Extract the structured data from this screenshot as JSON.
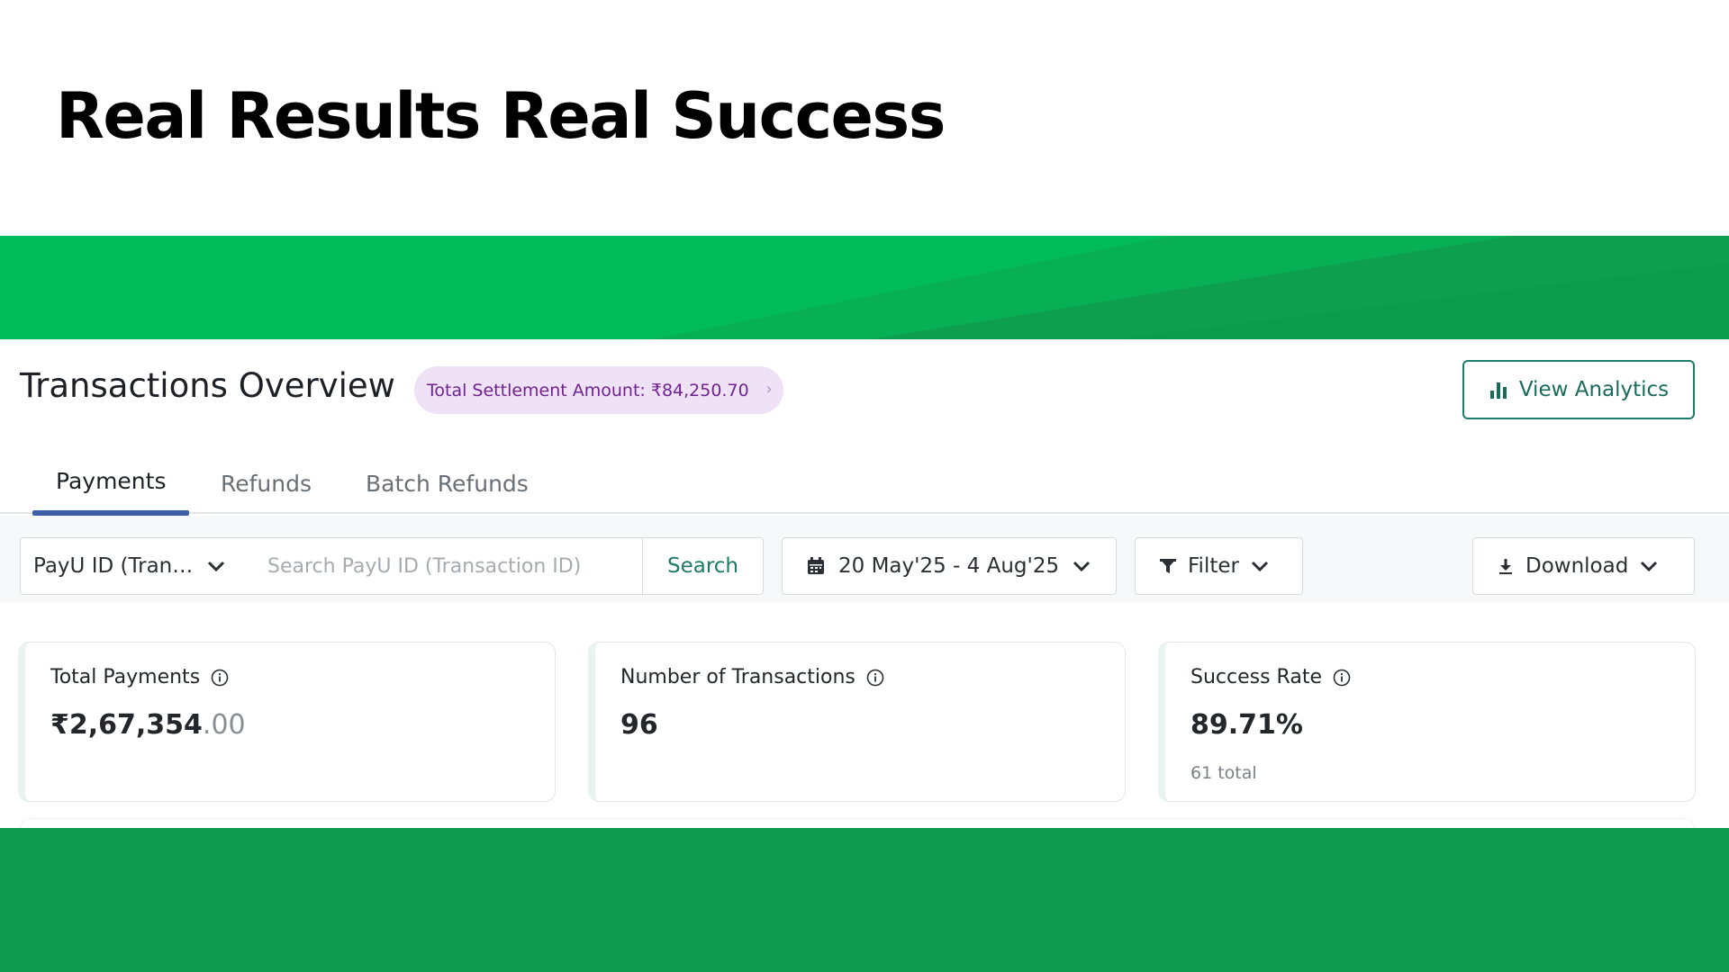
{
  "headline": "Real Results Real Success",
  "overview": {
    "title": "Transactions Overview",
    "settlement_label": "Total Settlement Amount: ₹84,250.70",
    "view_analytics_label": "View Analytics"
  },
  "tabs": [
    {
      "label": "Payments",
      "active": true
    },
    {
      "label": "Refunds",
      "active": false
    },
    {
      "label": "Batch Refunds",
      "active": false
    }
  ],
  "toolbar": {
    "search_type": "PayU ID (Trans...",
    "search_placeholder": "Search PayU ID (Transaction ID)",
    "search_button": "Search",
    "date_range": "20 May'25 - 4 Aug'25",
    "filter_label": "Filter",
    "download_label": "Download"
  },
  "metrics": [
    {
      "label": "Total Payments",
      "value_main": "₹2,67,354",
      "value_decimal": ".00"
    },
    {
      "label": "Number of Transactions",
      "value_main": "96"
    },
    {
      "label": "Success Rate",
      "value_main": "89.71%",
      "sub": "61 total"
    }
  ],
  "colors": {
    "band_top": "#02bb5a",
    "band_bottom": "#0f9a4f",
    "accent_teal": "#1c7a68",
    "tab_indicator": "#3d5fa9",
    "settlement_bg": "#f0e2f6",
    "settlement_text": "#6f2391"
  },
  "icons": [
    "bar-chart-icon",
    "chevron-down-icon",
    "calendar-icon",
    "filter-icon",
    "download-icon",
    "info-icon",
    "chevron-right-icon"
  ]
}
